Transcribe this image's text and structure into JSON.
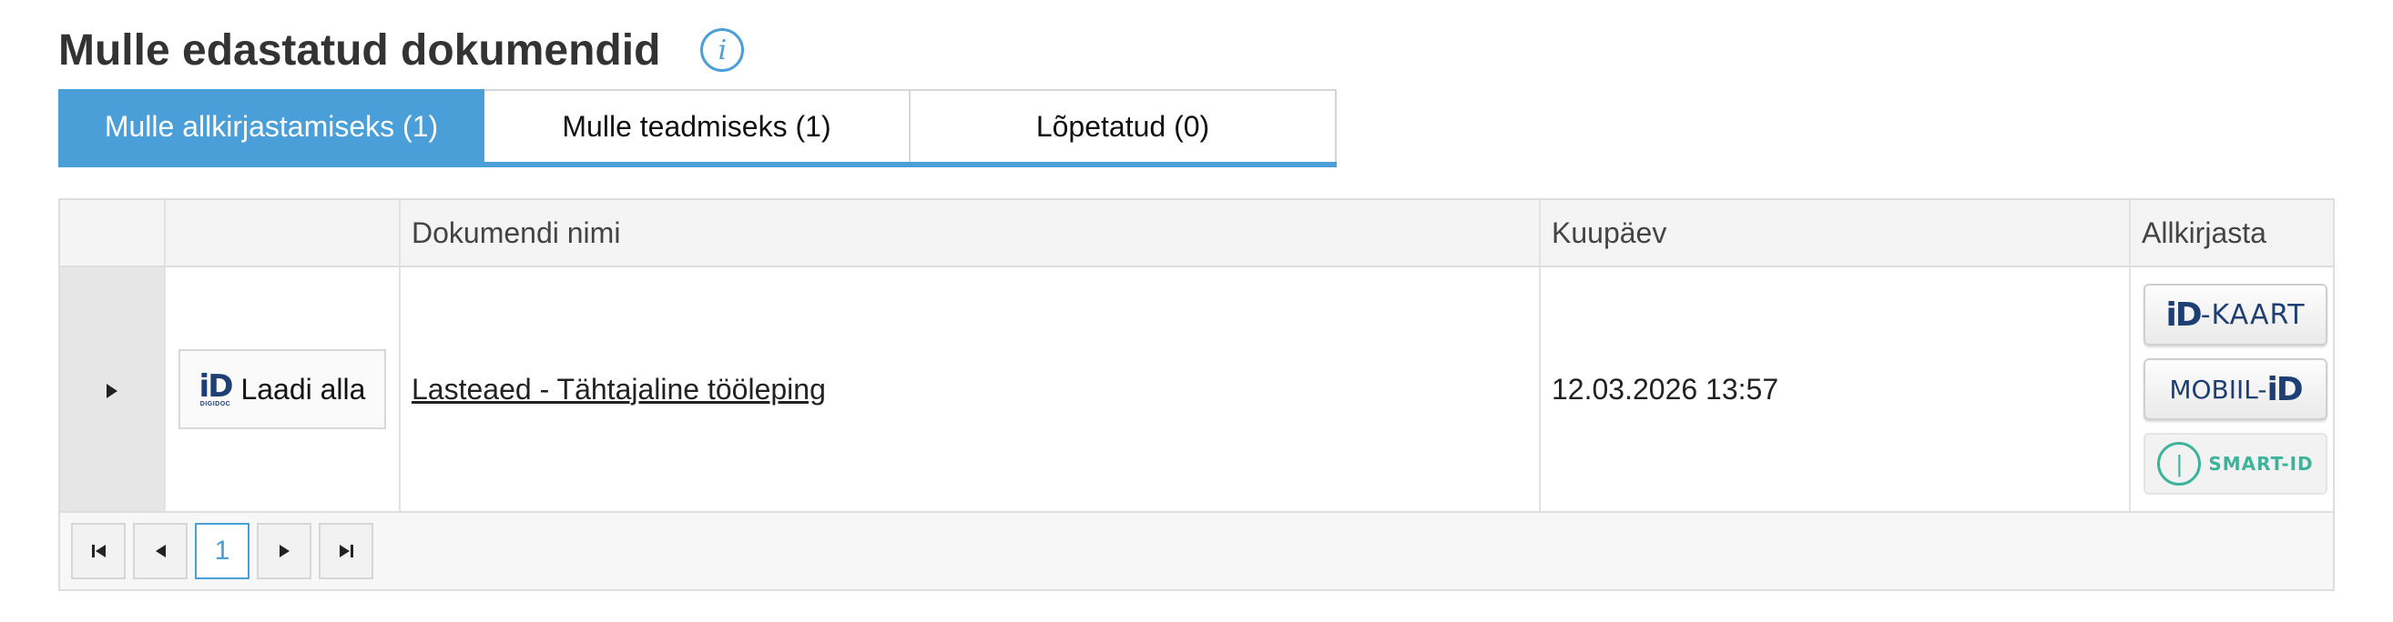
{
  "page": {
    "title": "Mulle edastatud dokumendid",
    "info_icon": "info-icon"
  },
  "tabs": [
    {
      "label": "Mulle allkirjastamiseks (1)",
      "active": true
    },
    {
      "label": "Mulle teadmiseks (1)",
      "active": false
    },
    {
      "label": "Lõpetatud (0)",
      "active": false
    }
  ],
  "table": {
    "columns": [
      "",
      "",
      "Dokumendi nimi",
      "Kuupäev",
      "Allkirjasta"
    ],
    "rows": [
      {
        "download_label": "Laadi alla",
        "logo": {
          "mark": "iD",
          "sub": "DIGIDOC"
        },
        "document_name": "Lasteaed - Tähtajaline tööleping",
        "date": "12.03.2026 13:57",
        "sign_options": {
          "id_card": {
            "logo": "iD",
            "text": "-KAART"
          },
          "mobile_id": {
            "text": "MOBIIL-",
            "logo": "iD"
          },
          "smart_id": {
            "text": "SMART-ID"
          }
        }
      }
    ]
  },
  "pager": {
    "current_page": "1",
    "icons": [
      "first-page-icon",
      "prev-page-icon",
      "next-page-icon",
      "last-page-icon"
    ]
  },
  "colors": {
    "accent": "#4a9fd8",
    "id_blue": "#1d3f73",
    "id_orange": "#e46a2a",
    "smart_id_green": "#3cb39b"
  }
}
